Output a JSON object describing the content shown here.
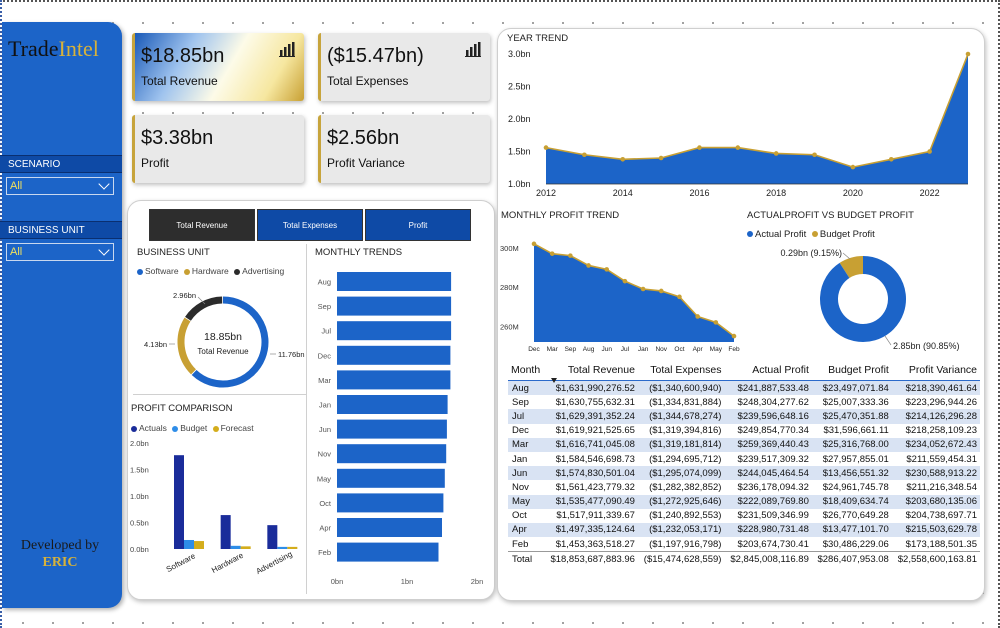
{
  "logo": {
    "part1": "Trade",
    "part2": "Intel"
  },
  "filters": [
    {
      "label": "SCENARIO",
      "value": "All"
    },
    {
      "label": "BUSINESS UNIT",
      "value": "All"
    }
  ],
  "developer": {
    "line1": "Developed by",
    "line2": "ERIC"
  },
  "kpis": [
    {
      "value": "$18.85bn",
      "label": "Total Revenue",
      "icon": "bar-chart-icon"
    },
    {
      "value": "($15.47bn)",
      "label": "Total Expenses",
      "icon": "bar-chart-icon"
    },
    {
      "value": "$3.38bn",
      "label": "Profit"
    },
    {
      "value": "$2.56bn",
      "label": "Profit Variance"
    }
  ],
  "tabs": [
    "Total Revenue",
    "Total Expenses",
    "Profit"
  ],
  "colors": {
    "primary": "#1c64c8",
    "dark_blue": "#1a2c9a",
    "gold": "#c8a033",
    "dark": "#2b2b2b",
    "active_tab": "#2d2d2d"
  },
  "business_unit": {
    "title": "BUSINESS UNIT",
    "legend": [
      "Software",
      "Hardware",
      "Advertising"
    ],
    "center_value": "18.85bn",
    "center_label": "Total Revenue",
    "slice_labels": [
      "11.76bn",
      "4.13bn",
      "2.96bn"
    ],
    "chart_data": {
      "type": "pie",
      "categories": [
        "Software",
        "Hardware",
        "Advertising"
      ],
      "values": [
        11.76,
        4.13,
        2.96
      ],
      "colors": [
        "#1c64c8",
        "#c8a033",
        "#2b2b2b"
      ]
    }
  },
  "monthly_trends": {
    "title": "MONTHLY TRENDS",
    "chart_data": {
      "type": "bar",
      "orientation": "horizontal",
      "categories": [
        "Aug",
        "Sep",
        "Jul",
        "Dec",
        "Mar",
        "Jan",
        "Jun",
        "Nov",
        "May",
        "Oct",
        "Apr",
        "Feb"
      ],
      "values": [
        1.63,
        1.63,
        1.63,
        1.62,
        1.62,
        1.58,
        1.57,
        1.56,
        1.54,
        1.52,
        1.5,
        1.45
      ],
      "x_ticks": [
        "0bn",
        "1bn",
        "2bn"
      ],
      "xlim": [
        0,
        2
      ]
    }
  },
  "profit_comparison": {
    "title": "PROFIT COMPARISON",
    "legend": [
      "Actuals",
      "Budget",
      "Forecast"
    ],
    "chart_data": {
      "type": "bar",
      "categories": [
        "Software",
        "Hardware",
        "Advertising"
      ],
      "series": [
        {
          "name": "Actuals",
          "values": [
            1.77,
            0.64,
            0.45
          ],
          "color": "#1a2c9a"
        },
        {
          "name": "Budget",
          "values": [
            0.17,
            0.06,
            0.04
          ],
          "color": "#2e8de8"
        },
        {
          "name": "Forecast",
          "values": [
            0.15,
            0.05,
            0.04
          ],
          "color": "#d4ad1c"
        }
      ],
      "y_ticks": [
        "0.0bn",
        "0.5bn",
        "1.0bn",
        "1.5bn",
        "2.0bn"
      ],
      "ylim": [
        0,
        2
      ]
    }
  },
  "year_trend": {
    "title": "YEAR TREND",
    "chart_data": {
      "type": "area",
      "x": [
        2012,
        2013,
        2014,
        2015,
        2016,
        2017,
        2018,
        2019,
        2020,
        2021,
        2022,
        2023
      ],
      "values": [
        1.56,
        1.45,
        1.38,
        1.4,
        1.56,
        1.56,
        1.47,
        1.45,
        1.26,
        1.38,
        1.5,
        3.0
      ],
      "x_ticks": [
        "2012",
        "2014",
        "2016",
        "2018",
        "2020",
        "2022"
      ],
      "y_ticks": [
        "1.0bn",
        "1.5bn",
        "2.0bn",
        "2.5bn",
        "3.0bn"
      ],
      "ylim": [
        1.0,
        3.0
      ]
    }
  },
  "monthly_profit_trend": {
    "title": "MONTHLY PROFIT TREND",
    "chart_data": {
      "type": "area",
      "categories": [
        "Dec",
        "Mar",
        "Sep",
        "Aug",
        "Jun",
        "Jul",
        "Jan",
        "Nov",
        "Oct",
        "Apr",
        "May",
        "Feb"
      ],
      "values": [
        302,
        297,
        296,
        291,
        289,
        283,
        279,
        278,
        275,
        265,
        262,
        255
      ],
      "y_ticks": [
        "260M",
        "280M",
        "300M"
      ],
      "ylim": [
        252,
        306
      ]
    }
  },
  "actual_vs_budget": {
    "title": "ACTUALPROFIT VS BUDGET PROFIT",
    "legend": [
      "Actual Profit",
      "Budget Profit"
    ],
    "labels": [
      "0.29bn (9.15%)",
      "2.85bn (90.85%)"
    ],
    "chart_data": {
      "type": "pie",
      "categories": [
        "Actual Profit",
        "Budget Profit"
      ],
      "values": [
        90.85,
        9.15
      ],
      "colors": [
        "#1c64c8",
        "#c8a033"
      ]
    }
  },
  "table": {
    "headers": [
      "Month",
      "Total Revenue",
      "Total Expenses",
      "Actual Profit",
      "Budget Profit",
      "Profit Variance"
    ],
    "rows": [
      [
        "Aug",
        "$1,631,990,276.52",
        "($1,340,600,940)",
        "$241,887,533.48",
        "$23,497,071.84",
        "$218,390,461.64"
      ],
      [
        "Sep",
        "$1,630,755,632.31",
        "($1,334,831,884)",
        "$248,304,277.62",
        "$25,007,333.36",
        "$223,296,944.26"
      ],
      [
        "Jul",
        "$1,629,391,352.24",
        "($1,344,678,274)",
        "$239,596,648.16",
        "$25,470,351.88",
        "$214,126,296.28"
      ],
      [
        "Dec",
        "$1,619,921,525.65",
        "($1,319,394,816)",
        "$249,854,770.34",
        "$31,596,661.11",
        "$218,258,109.23"
      ],
      [
        "Mar",
        "$1,616,741,045.08",
        "($1,319,181,814)",
        "$259,369,440.43",
        "$25,316,768.00",
        "$234,052,672.43"
      ],
      [
        "Jan",
        "$1,584,546,698.73",
        "($1,294,695,712)",
        "$239,517,309.32",
        "$27,957,855.01",
        "$211,559,454.31"
      ],
      [
        "Jun",
        "$1,574,830,501.04",
        "($1,295,074,099)",
        "$244,045,464.54",
        "$13,456,551.32",
        "$230,588,913.22"
      ],
      [
        "Nov",
        "$1,561,423,779.32",
        "($1,282,382,852)",
        "$236,178,094.32",
        "$24,961,745.78",
        "$211,216,348.54"
      ],
      [
        "May",
        "$1,535,477,090.49",
        "($1,272,925,646)",
        "$222,089,769.80",
        "$18,409,634.74",
        "$203,680,135.06"
      ],
      [
        "Oct",
        "$1,517,911,339.67",
        "($1,240,892,553)",
        "$231,509,346.99",
        "$26,770,649.28",
        "$204,738,697.71"
      ],
      [
        "Apr",
        "$1,497,335,124.64",
        "($1,232,053,171)",
        "$228,980,731.48",
        "$13,477,101.70",
        "$215,503,629.78"
      ],
      [
        "Feb",
        "$1,453,363,518.27",
        "($1,197,916,798)",
        "$203,674,730.41",
        "$30,486,229.06",
        "$173,188,501.35"
      ]
    ],
    "total": [
      "Total",
      "$18,853,687,883.96",
      "($15,474,628,559)",
      "$2,845,008,116.89",
      "$286,407,953.08",
      "$2,558,600,163.81"
    ]
  }
}
